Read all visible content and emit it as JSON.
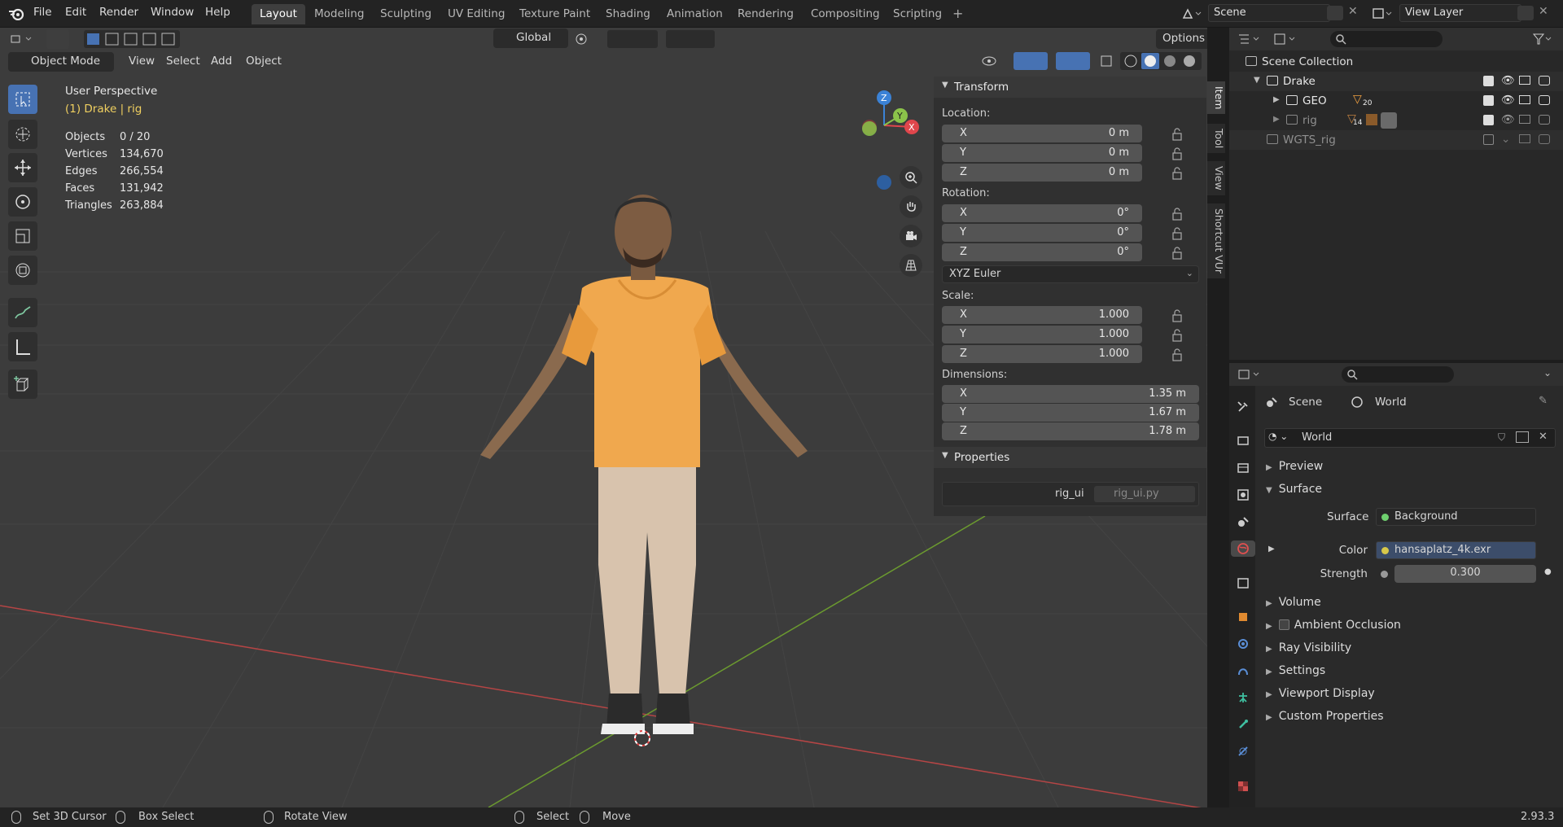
{
  "menus": [
    "File",
    "Edit",
    "Render",
    "Window",
    "Help"
  ],
  "workspaces": [
    "Layout",
    "Modeling",
    "Sculpting",
    "UV Editing",
    "Texture Paint",
    "Shading",
    "Animation",
    "Rendering",
    "Compositing",
    "Scripting"
  ],
  "scene": {
    "name": "Scene",
    "view_layer": "View Layer"
  },
  "header": {
    "orientation": "Global",
    "options": "Options",
    "mode": "Object Mode",
    "view": "View",
    "select": "Select",
    "add": "Add",
    "object": "Object"
  },
  "viewport": {
    "perspective": "User Perspective",
    "context": "(1) Drake | rig",
    "stats": [
      {
        "label": "Objects",
        "value": "0 / 20"
      },
      {
        "label": "Vertices",
        "value": "134,670"
      },
      {
        "label": "Edges",
        "value": "266,554"
      },
      {
        "label": "Faces",
        "value": "131,942"
      },
      {
        "label": "Triangles",
        "value": "263,884"
      }
    ],
    "gizmo": {
      "z": "Z",
      "y": "Y",
      "x": "X"
    }
  },
  "npanel": {
    "transform": "Transform",
    "location": "Location:",
    "loc": [
      {
        "k": "X",
        "v": "0 m"
      },
      {
        "k": "Y",
        "v": "0 m"
      },
      {
        "k": "Z",
        "v": "0 m"
      }
    ],
    "rotation": "Rotation:",
    "rot": [
      {
        "k": "X",
        "v": "0°"
      },
      {
        "k": "Y",
        "v": "0°"
      },
      {
        "k": "Z",
        "v": "0°"
      }
    ],
    "rot_mode": "XYZ Euler",
    "scale": "Scale:",
    "scl": [
      {
        "k": "X",
        "v": "1.000"
      },
      {
        "k": "Y",
        "v": "1.000"
      },
      {
        "k": "Z",
        "v": "1.000"
      }
    ],
    "dimensions": "Dimensions:",
    "dim": [
      {
        "k": "X",
        "v": "1.35 m"
      },
      {
        "k": "Y",
        "v": "1.67 m"
      },
      {
        "k": "Z",
        "v": "1.78 m"
      }
    ],
    "properties": "Properties",
    "prop_key": "rig_ui",
    "prop_val": "rig_ui.py",
    "tabs": [
      "Item",
      "Tool",
      "View",
      "Shortcut VUr"
    ]
  },
  "outliner": {
    "root": "Scene Collection",
    "items": [
      {
        "name": "Drake",
        "badge": ""
      },
      {
        "name": "GEO",
        "badge": "20"
      },
      {
        "name": "rig",
        "badge": "14"
      },
      {
        "name": "WGTS_rig",
        "badge": ""
      }
    ]
  },
  "properties_editor": {
    "breadcrumb_scene": "Scene",
    "breadcrumb_world": "World",
    "world_name": "World",
    "sections": {
      "preview": "Preview",
      "surface": "Surface",
      "volume": "Volume",
      "ao": "Ambient Occlusion",
      "ray": "Ray Visibility",
      "settings": "Settings",
      "viewport": "Viewport Display",
      "custom": "Custom Properties"
    },
    "surface_label": "Surface",
    "surface_value": "Background",
    "color_label": "Color",
    "color_value": "hansaplatz_4k.exr",
    "strength_label": "Strength",
    "strength_value": "0.300"
  },
  "status": {
    "cursor": "Set 3D Cursor",
    "box": "Box Select",
    "rotate": "Rotate View",
    "select": "Select",
    "move": "Move",
    "version": "2.93.3"
  },
  "colors": {
    "accent": "#4772b3",
    "x_axis": "#e0464c",
    "y_axis": "#8bc34a",
    "z_axis": "#3b82d6",
    "hoodie": "#f0a84e"
  }
}
